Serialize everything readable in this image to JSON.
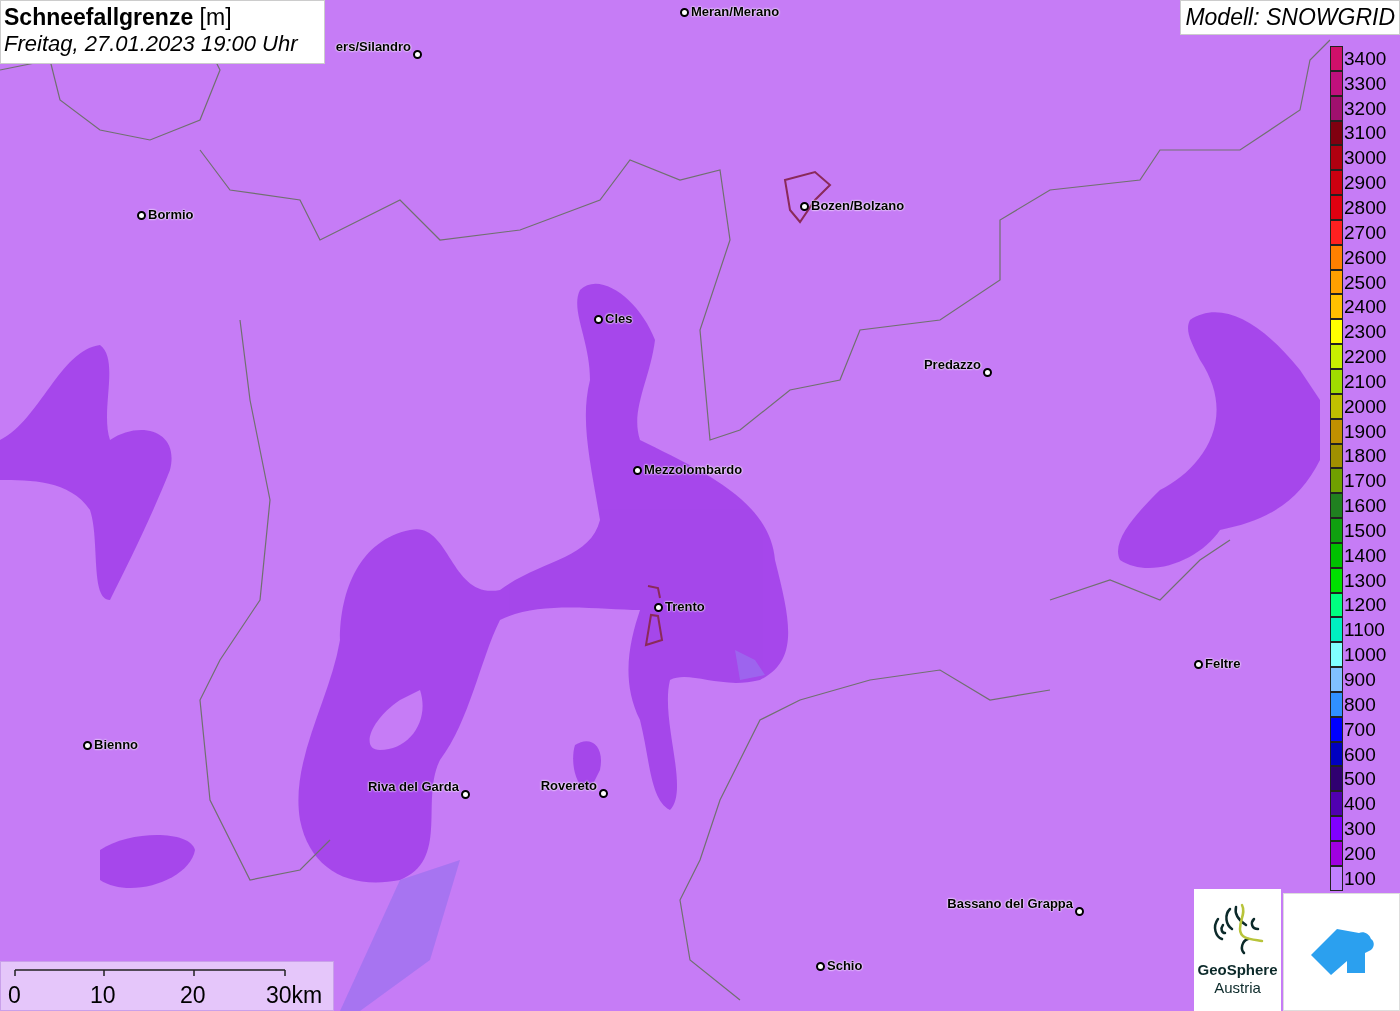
{
  "title": {
    "name": "Schneefallgrenze",
    "unit": "[m]",
    "datetime": "Freitag, 27.01.2023 19:00 Uhr"
  },
  "model": "Modell: SNOWGRID",
  "cities": [
    {
      "name": "ers/Silandro"
    },
    {
      "name": "Meran/Merano"
    },
    {
      "name": "Bormio"
    },
    {
      "name": "Bozen/Bolzano"
    },
    {
      "name": "Cles"
    },
    {
      "name": "Predazzo"
    },
    {
      "name": "Mezzolombardo"
    },
    {
      "name": "Trento"
    },
    {
      "name": "Feltre"
    },
    {
      "name": "Bienno"
    },
    {
      "name": "Riva del Garda"
    },
    {
      "name": "Rovereto"
    },
    {
      "name": "Bassano del Grappa"
    },
    {
      "name": "Schio"
    }
  ],
  "legend": [
    {
      "label": "3400",
      "color": "#d0106a"
    },
    {
      "label": "3300",
      "color": "#c0107c"
    },
    {
      "label": "3200",
      "color": "#a0106e"
    },
    {
      "label": "3100",
      "color": "#800010"
    },
    {
      "label": "3000",
      "color": "#b00010"
    },
    {
      "label": "2900",
      "color": "#cc0010"
    },
    {
      "label": "2800",
      "color": "#e00010"
    },
    {
      "label": "2700",
      "color": "#ff2020"
    },
    {
      "label": "2600",
      "color": "#ff8000"
    },
    {
      "label": "2500",
      "color": "#ffa000"
    },
    {
      "label": "2400",
      "color": "#ffc000"
    },
    {
      "label": "2300",
      "color": "#ffff00"
    },
    {
      "label": "2200",
      "color": "#c8f000"
    },
    {
      "label": "2100",
      "color": "#a0dc00"
    },
    {
      "label": "2000",
      "color": "#c0c000"
    },
    {
      "label": "1900",
      "color": "#c09000"
    },
    {
      "label": "1800",
      "color": "#a09000"
    },
    {
      "label": "1700",
      "color": "#70a000"
    },
    {
      "label": "1600",
      "color": "#208020"
    },
    {
      "label": "1500",
      "color": "#10a010"
    },
    {
      "label": "1400",
      "color": "#00c000"
    },
    {
      "label": "1300",
      "color": "#00e000"
    },
    {
      "label": "1200",
      "color": "#00ff80"
    },
    {
      "label": "1100",
      "color": "#00f0c0"
    },
    {
      "label": "1000",
      "color": "#80ffff"
    },
    {
      "label": "900",
      "color": "#80c0ff"
    },
    {
      "label": "800",
      "color": "#3090ff"
    },
    {
      "label": "700",
      "color": "#0000ff"
    },
    {
      "label": "600",
      "color": "#0000c0"
    },
    {
      "label": "500",
      "color": "#300070"
    },
    {
      "label": "400",
      "color": "#5000b0"
    },
    {
      "label": "300",
      "color": "#8000ff"
    },
    {
      "label": "200",
      "color": "#a000e0"
    },
    {
      "label": "100",
      "color": "#c080ff"
    }
  ],
  "scale": [
    "0",
    "10",
    "20",
    "30km"
  ],
  "logo": {
    "line1": "GeoSphere",
    "line2": "Austria"
  }
}
